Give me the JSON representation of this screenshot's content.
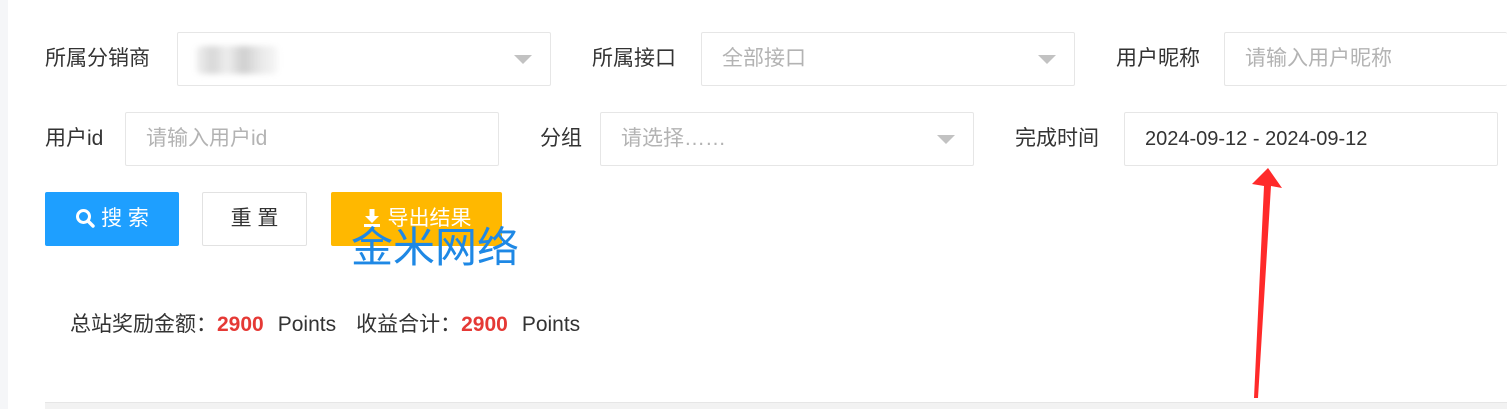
{
  "filters": {
    "distributor": {
      "label": "所属分销商",
      "value": ""
    },
    "interface": {
      "label": "所属接口",
      "placeholder": "全部接口"
    },
    "nickname": {
      "label": "用户昵称",
      "placeholder": "请输入用户昵称"
    },
    "user_id": {
      "label": "用户id",
      "placeholder": "请输入用户id"
    },
    "group": {
      "label": "分组",
      "placeholder": "请选择……"
    },
    "finish_time": {
      "label": "完成时间",
      "value": "2024-09-12 - 2024-09-12"
    }
  },
  "buttons": {
    "search": "搜 索",
    "reset": "重 置",
    "export": "导出结果"
  },
  "watermark": "金米网络",
  "summary": {
    "reward_label": "总站奖励金额：",
    "reward_value": "2900",
    "reward_unit": "Points",
    "income_label": "收益合计：",
    "income_value": "2900",
    "income_unit": "Points"
  },
  "colors": {
    "primary": "#1e9fff",
    "warning": "#ffb800",
    "highlight": "#e53935",
    "annotation": "#ff2a2a"
  }
}
